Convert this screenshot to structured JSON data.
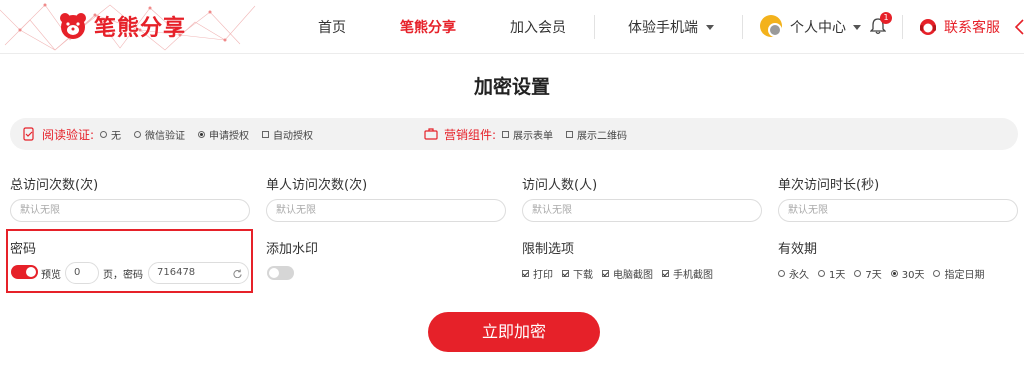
{
  "header": {
    "logo_text": "笔熊分享",
    "nav": [
      {
        "label": "首页",
        "active": false
      },
      {
        "label": "笔熊分享",
        "active": true
      },
      {
        "label": "加入会员",
        "active": false
      },
      {
        "label": "体验手机端",
        "active": false,
        "dropdown": true
      }
    ],
    "user_label": "个人中心",
    "notification_count": "1",
    "service_label": "联系客服"
  },
  "page_title": "加密设置",
  "options_bar": {
    "read_verify": {
      "label": "阅读验证:",
      "options": [
        {
          "label": "无",
          "selected": false
        },
        {
          "label": "微信验证",
          "selected": false
        },
        {
          "label": "申请授权",
          "selected": true
        },
        {
          "label": "自动授权",
          "selected": false
        }
      ]
    },
    "marketing": {
      "label": "营销组件:",
      "options": [
        {
          "label": "展示表单",
          "checked": false
        },
        {
          "label": "展示二维码",
          "checked": false
        }
      ]
    }
  },
  "fields": [
    {
      "label": "总访问次数(次)",
      "placeholder": "默认无限"
    },
    {
      "label": "单人访问次数(次)",
      "placeholder": "默认无限"
    },
    {
      "label": "访问人数(人)",
      "placeholder": "默认无限"
    },
    {
      "label": "单次访问时长(秒)",
      "placeholder": "默认无限"
    }
  ],
  "password": {
    "label": "密码",
    "enabled": true,
    "preview_label": "预览",
    "preview_pages": "0",
    "pages_suffix": "页，密码",
    "password_value": "716478"
  },
  "watermark": {
    "label": "添加水印",
    "enabled": false
  },
  "restrictions": {
    "label": "限制选项",
    "options": [
      {
        "label": "打印",
        "checked": true
      },
      {
        "label": "下载",
        "checked": true
      },
      {
        "label": "电脑截图",
        "checked": true
      },
      {
        "label": "手机截图",
        "checked": true
      }
    ]
  },
  "validity": {
    "label": "有效期",
    "options": [
      {
        "label": "永久",
        "selected": false
      },
      {
        "label": "1天",
        "selected": false
      },
      {
        "label": "7天",
        "selected": false
      },
      {
        "label": "30天",
        "selected": true
      },
      {
        "label": "指定日期",
        "selected": false
      }
    ]
  },
  "submit_label": "立即加密",
  "colors": {
    "accent": "#e62129",
    "bar_bg": "#f2f2f2"
  }
}
